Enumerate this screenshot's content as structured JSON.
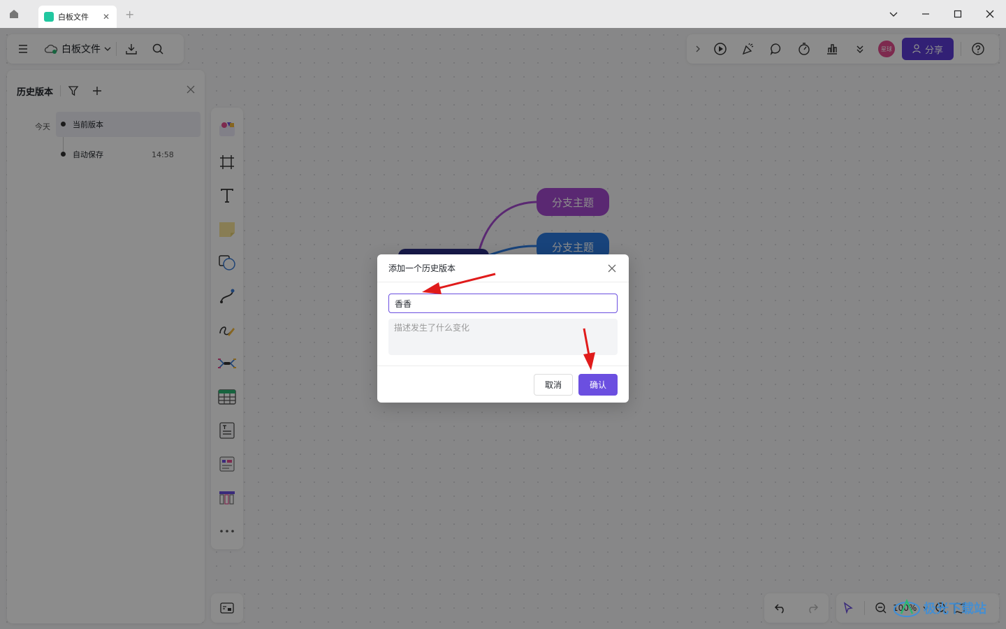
{
  "window": {
    "tab_title": "白板文件",
    "accent": "#6b4fe0"
  },
  "toolbar": {
    "doc_name": "白板文件"
  },
  "top_right": {
    "avatar_text": "星球",
    "share_label": "分享"
  },
  "history_panel": {
    "title": "历史版本",
    "day_label": "今天",
    "items": [
      {
        "label": "当前版本",
        "time": ""
      },
      {
        "label": "自动保存",
        "time": "14:58"
      }
    ]
  },
  "mindmap": {
    "branches": [
      {
        "label": "分支主题",
        "color": "#a54ad0"
      },
      {
        "label": "分支主题",
        "color": "#2d7be0"
      }
    ]
  },
  "zoom": {
    "value": "100%"
  },
  "dialog": {
    "title": "添加一个历史版本",
    "name_value": "香香",
    "desc_placeholder": "描述发生了什么变化",
    "cancel_label": "取消",
    "confirm_label": "确认"
  },
  "watermark": {
    "text": "极光下载站"
  }
}
